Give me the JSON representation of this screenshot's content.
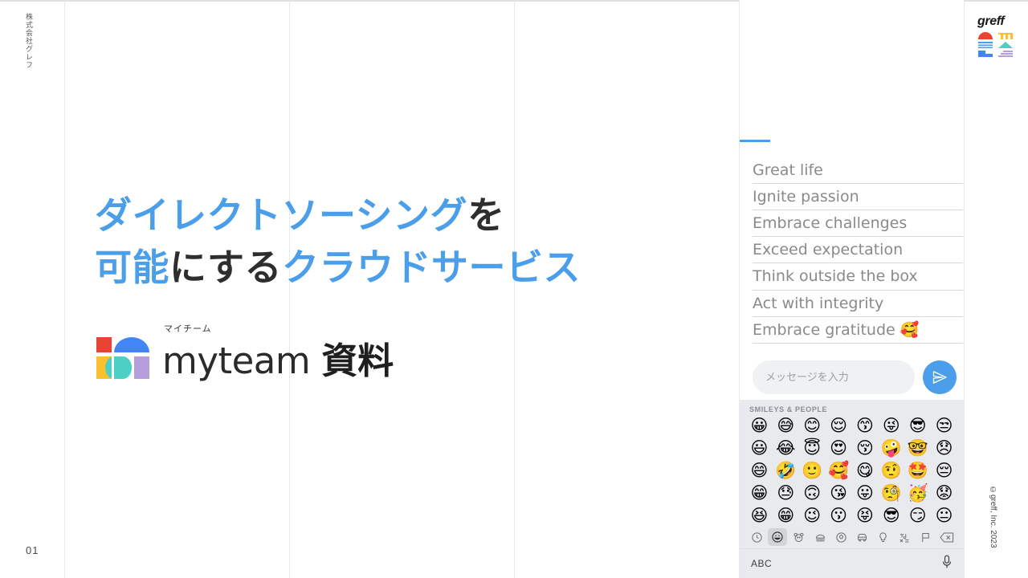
{
  "slide": {
    "company_vertical": "株式会社グレフ",
    "page_number": "01",
    "copyright": "©greff, Inc. 2023",
    "brand_wordmark": "greff",
    "accent_blue": "#4a9eea",
    "text_dark": "#2e2e2e"
  },
  "headline": {
    "line1_blue_a": "ダイレクトソーシング",
    "line1_dark_b": "を",
    "line2_blue_a": "可能",
    "line2_dark_b": "にする",
    "line2_blue_c": "クラウドサービス"
  },
  "product_logo": {
    "furigana": "マイチーム",
    "wordmark": "myteam",
    "suffix": "資料",
    "mark_colors": {
      "red": "#ea4335",
      "yellow": "#fbc02d",
      "blue": "#4285f4",
      "teal": "#4dd0c4",
      "purple": "#b39ddb"
    }
  },
  "chat_panel": {
    "values": [
      "Great life",
      "Ignite passion",
      "Embrace challenges",
      "Exceed expectation",
      "Think outside the box",
      "Act with integrity",
      "Embrace gratitude 🥰"
    ],
    "input_placeholder": "メッセージを入力",
    "input_value": "",
    "send_icon": "paper-plane-icon"
  },
  "emoji_keyboard": {
    "section_title": "SMILEYS & PEOPLE",
    "rows": [
      [
        "😀",
        "😅",
        "😊",
        "😌",
        "😙",
        "😜",
        "😎",
        "😒"
      ],
      [
        "😃",
        "😂",
        "😇",
        "😍",
        "😚",
        "🤪",
        "🤓",
        "😞"
      ],
      [
        "😄",
        "🤣",
        "🙂",
        "🥰",
        "😋",
        "🤨",
        "🤩",
        "😔"
      ],
      [
        "😁",
        "😓",
        "🙃",
        "😘",
        "😛",
        "🧐",
        "🥳",
        "😟"
      ],
      [
        "😆",
        "😁",
        "😉",
        "😗",
        "😝",
        "😎",
        "😏",
        "😐"
      ]
    ],
    "categories": [
      {
        "name": "recent-icon",
        "glyph": "🕐",
        "active": false
      },
      {
        "name": "smileys-icon",
        "glyph": "😀",
        "active": true
      },
      {
        "name": "animals-icon",
        "glyph": "🐻",
        "active": false
      },
      {
        "name": "food-icon",
        "glyph": "🍔",
        "active": false
      },
      {
        "name": "activity-icon",
        "glyph": "⚽",
        "active": false
      },
      {
        "name": "travel-icon",
        "glyph": "🚗",
        "active": false
      },
      {
        "name": "objects-icon",
        "glyph": "💡",
        "active": false
      },
      {
        "name": "symbols-icon",
        "glyph": "🔣",
        "active": false
      },
      {
        "name": "flags-icon",
        "glyph": "🏳",
        "active": false
      },
      {
        "name": "backspace-icon",
        "glyph": "⌫",
        "active": false
      }
    ],
    "abc_label": "ABC",
    "mic_icon": "microphone-icon"
  }
}
